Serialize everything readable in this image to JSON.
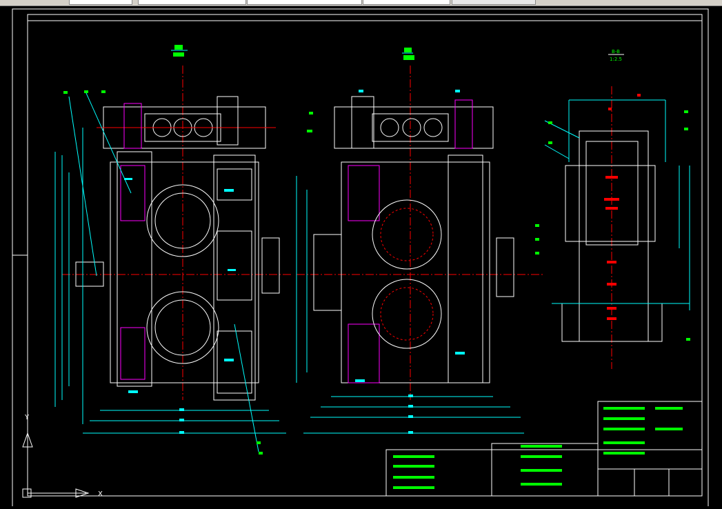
{
  "app": {
    "canvas_background": "#000000"
  },
  "colors": {
    "frame": "#ffffff",
    "outline": "#00ffff",
    "centerline": "#ff0000",
    "text": "#00ff00",
    "hidden": "#ff00ff",
    "dimension_mark": "#00ffff"
  },
  "drawing": {
    "views": [
      {
        "id": "left-view"
      },
      {
        "id": "front-view"
      },
      {
        "id": "section-view",
        "label": "B-B",
        "scale": "1:2.5"
      }
    ]
  },
  "ucs": {
    "x_axis": "X",
    "y_axis": "Y"
  }
}
